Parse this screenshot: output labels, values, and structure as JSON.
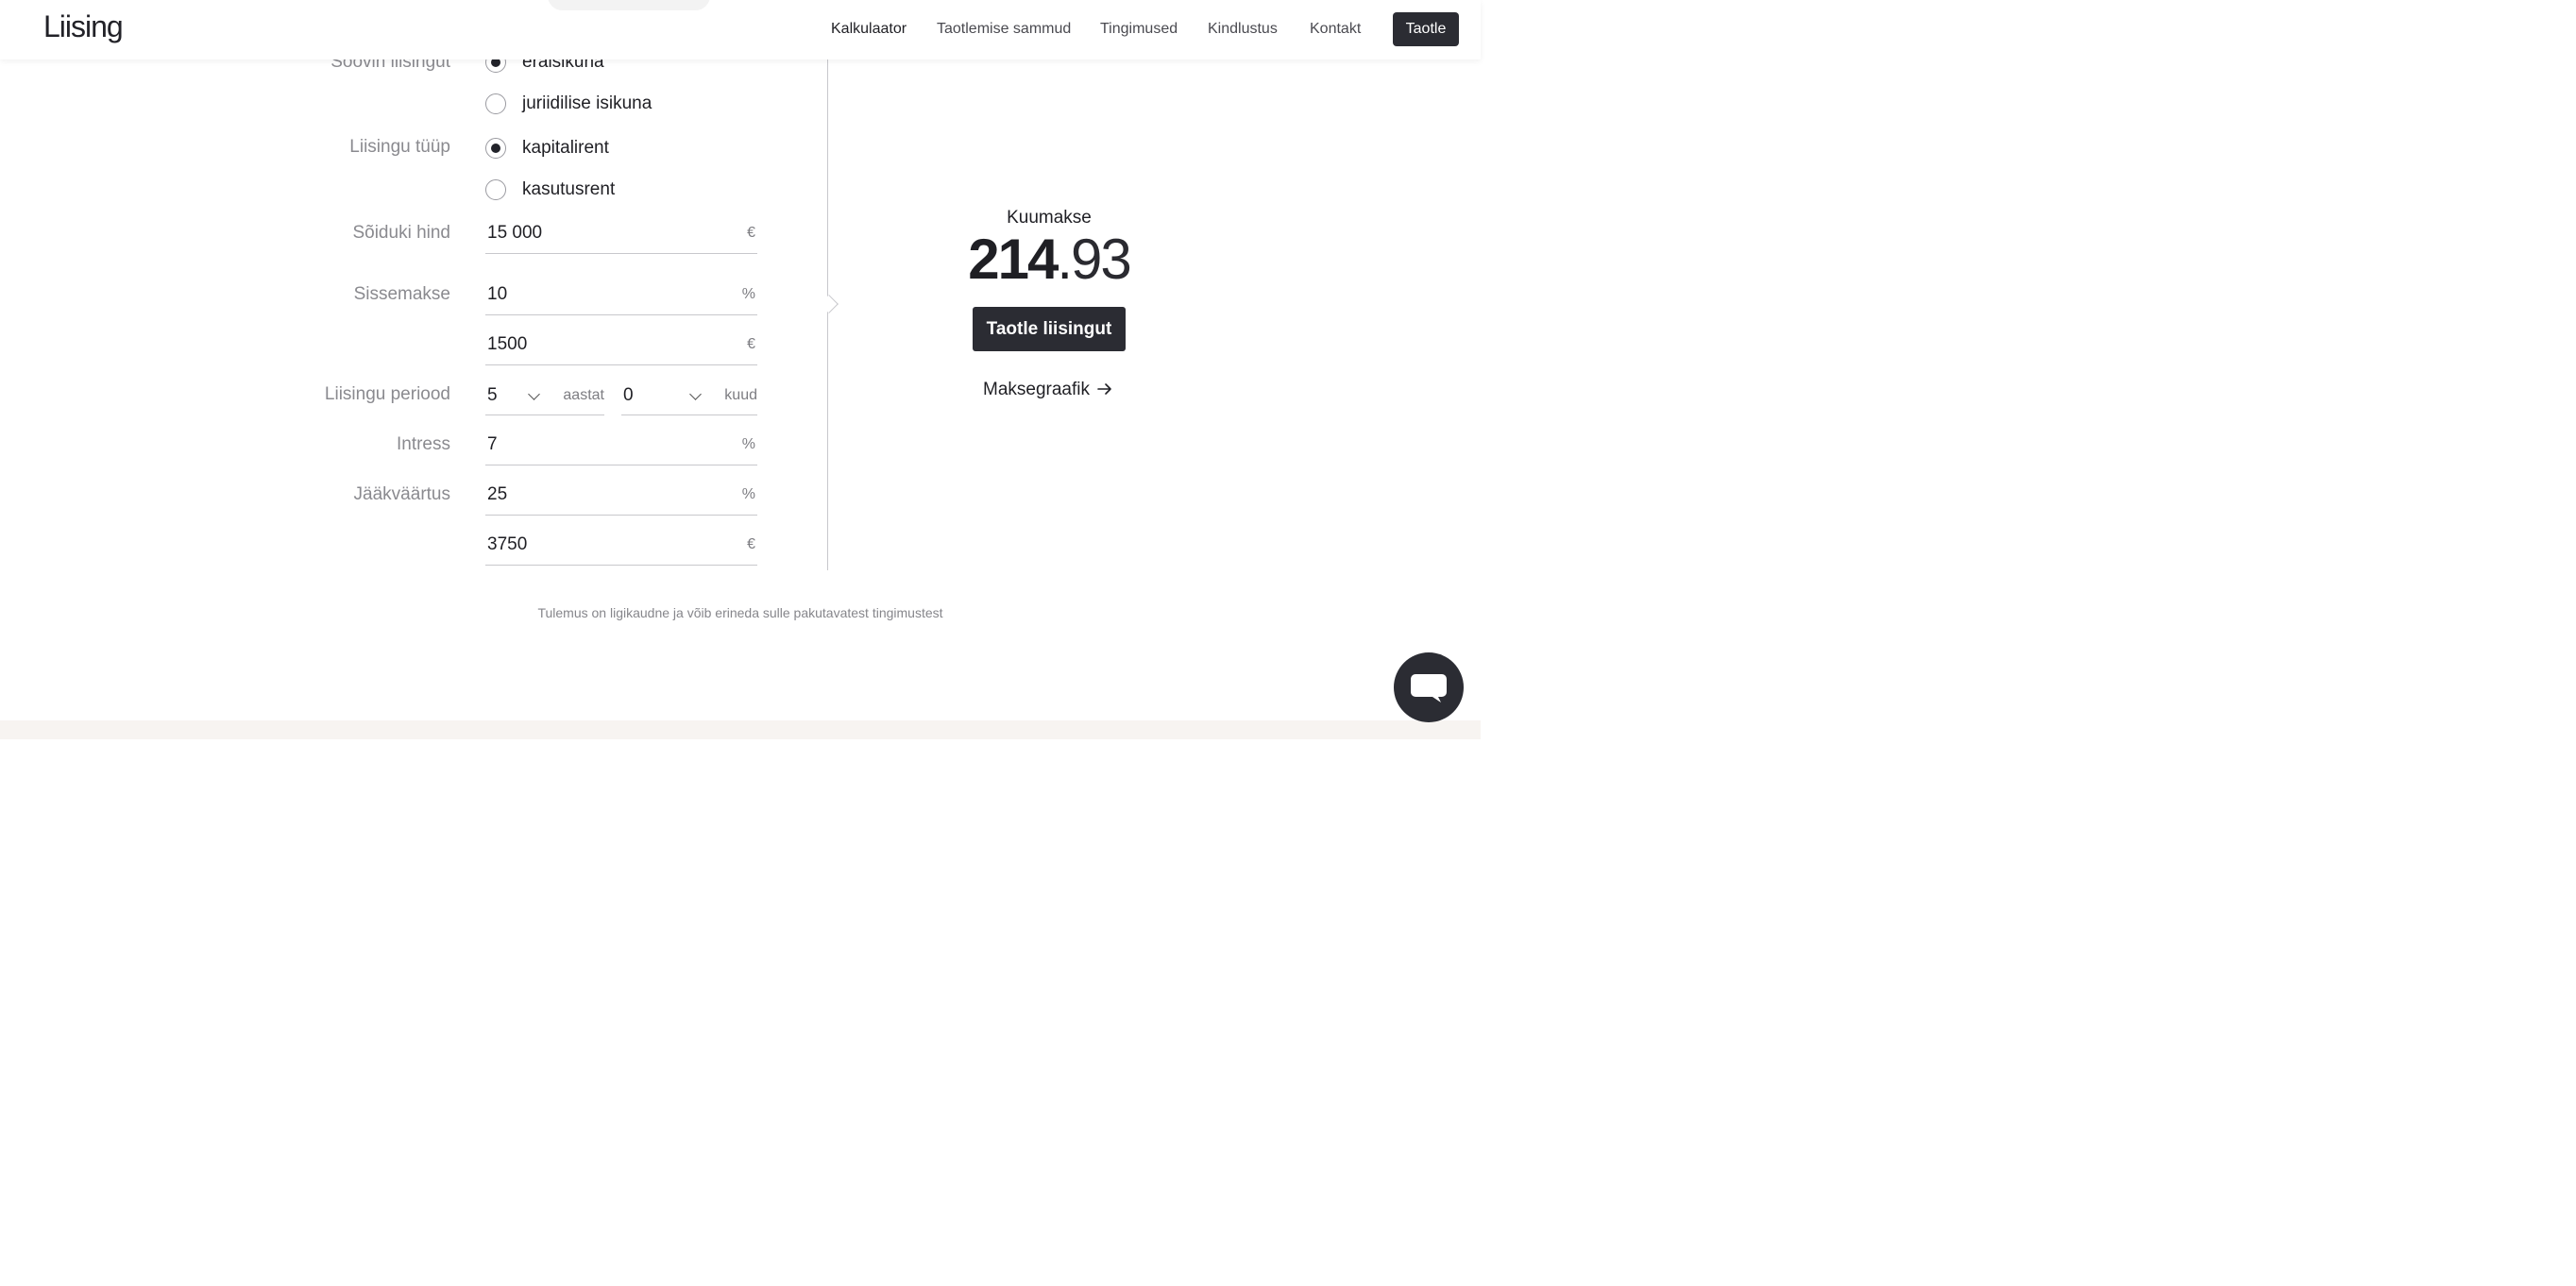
{
  "header": {
    "logo": "Liising",
    "nav": [
      "Kalkulaator",
      "Taotlemise sammud",
      "Tingimused",
      "Kindlustus",
      "Kontakt"
    ],
    "active_nav": "Kalkulaator",
    "cta_label": "Taotle"
  },
  "form": {
    "applicant": {
      "label": "Soovin liisingut",
      "options": [
        "eraisikuna",
        "juriidilise isikuna"
      ],
      "selected": "eraisikuna"
    },
    "lease_type": {
      "label": "Liisingu tüüp",
      "options": [
        "kapitalirent",
        "kasutusrent"
      ],
      "selected": "kapitalirent"
    },
    "vehicle_price": {
      "label": "Sõiduki hind",
      "value": "15 000",
      "unit": "€"
    },
    "down_payment": {
      "label": "Sissemakse",
      "percent_value": "10",
      "percent_unit": "%",
      "amount_value": "1500",
      "amount_unit": "€"
    },
    "period": {
      "label": "Liisingu periood",
      "years_value": "5",
      "years_unit": "aastat",
      "months_value": "0",
      "months_unit": "kuud"
    },
    "interest": {
      "label": "Intress",
      "value": "7",
      "unit": "%"
    },
    "residual": {
      "label": "Jääkväärtus",
      "percent_value": "25",
      "percent_unit": "%",
      "amount_value": "3750",
      "amount_unit": "€"
    }
  },
  "result": {
    "label": "Kuumakse",
    "value_int": "214",
    "value_sep": ".",
    "value_dec": "93",
    "apply_label": "Taotle liisingut",
    "schedule_label": "Maksegraafik"
  },
  "disclaimer": "Tulemus on ligikaudne ja võib erineda sulle pakutavatest tingimustest",
  "colors": {
    "primary": "#2b2c33",
    "text": "#1f1f24",
    "muted": "#8a8a8f",
    "footer": "#f7f4f1"
  }
}
